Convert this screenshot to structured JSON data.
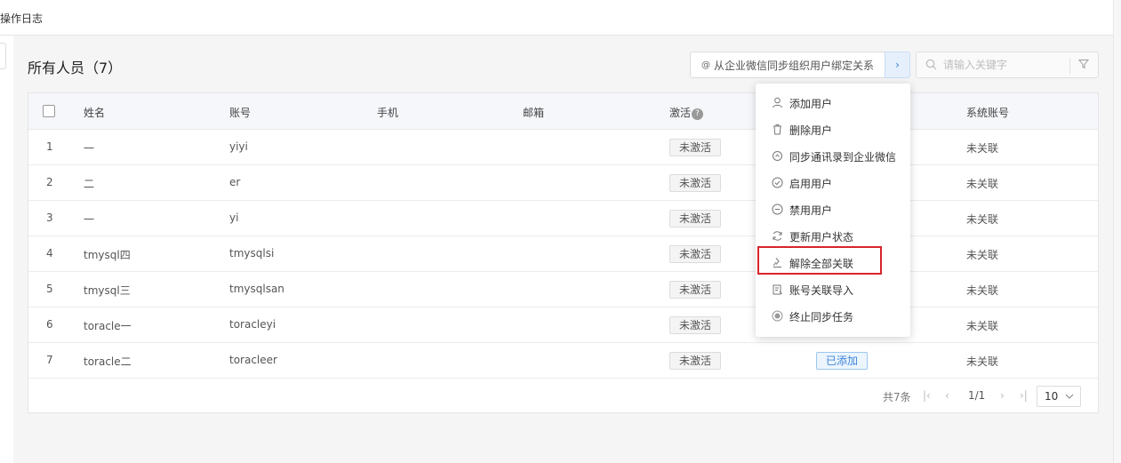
{
  "topbar": {
    "title": "操作日志"
  },
  "page": {
    "title": "所有人员（7）"
  },
  "toolbar": {
    "sync_label": "从企业微信同步组织用户绑定关系",
    "sync_icon": "at-icon",
    "more_arrow": "›",
    "search_placeholder": "请输入关键字"
  },
  "table": {
    "columns": [
      "姓名",
      "账号",
      "手机",
      "邮箱",
      "激活",
      "系统账号"
    ],
    "help_mark": "?",
    "rows": [
      {
        "index": "1",
        "name": "一",
        "account": "yiyi",
        "phone": "",
        "email": "",
        "activation": "未激活",
        "extra": "",
        "system_account": "未关联"
      },
      {
        "index": "2",
        "name": "二",
        "account": "er",
        "phone": "",
        "email": "",
        "activation": "未激活",
        "extra": "",
        "system_account": "未关联"
      },
      {
        "index": "3",
        "name": "一",
        "account": "yi",
        "phone": "",
        "email": "",
        "activation": "未激活",
        "extra": "",
        "system_account": "未关联"
      },
      {
        "index": "4",
        "name": "tmysql四",
        "account": "tmysqlsi",
        "phone": "",
        "email": "",
        "activation": "未激活",
        "extra": "",
        "system_account": "未关联"
      },
      {
        "index": "5",
        "name": "tmysql三",
        "account": "tmysqlsan",
        "phone": "",
        "email": "",
        "activation": "未激活",
        "extra": "",
        "system_account": "未关联"
      },
      {
        "index": "6",
        "name": "toracle一",
        "account": "toracleyi",
        "phone": "",
        "email": "",
        "activation": "未激活",
        "extra": "",
        "system_account": "未关联"
      },
      {
        "index": "7",
        "name": "toracle二",
        "account": "toracleer",
        "phone": "",
        "email": "",
        "activation": "未激活",
        "extra": "已添加",
        "system_account": "未关联"
      }
    ]
  },
  "pager": {
    "total": "共7条",
    "first": "|‹",
    "prev": "‹",
    "page": "1/1",
    "next": "›",
    "last": "›|",
    "page_size": "10"
  },
  "menu": {
    "items": [
      {
        "label": "添加用户",
        "icon": "user-icon"
      },
      {
        "label": "删除用户",
        "icon": "trash-icon"
      },
      {
        "label": "同步通讯录到企业微信",
        "icon": "sync-contacts-icon"
      },
      {
        "label": "启用用户",
        "icon": "check-circle-icon"
      },
      {
        "label": "禁用用户",
        "icon": "minus-circle-icon"
      },
      {
        "label": "更新用户状态",
        "icon": "refresh-icon"
      },
      {
        "label": "解除全部关联",
        "icon": "unlink-icon"
      },
      {
        "label": "账号关联导入",
        "icon": "import-icon"
      },
      {
        "label": "终止同步任务",
        "icon": "stop-icon"
      }
    ]
  },
  "colors": {
    "accent": "#3d84d8",
    "highlight": "#d9242c"
  }
}
